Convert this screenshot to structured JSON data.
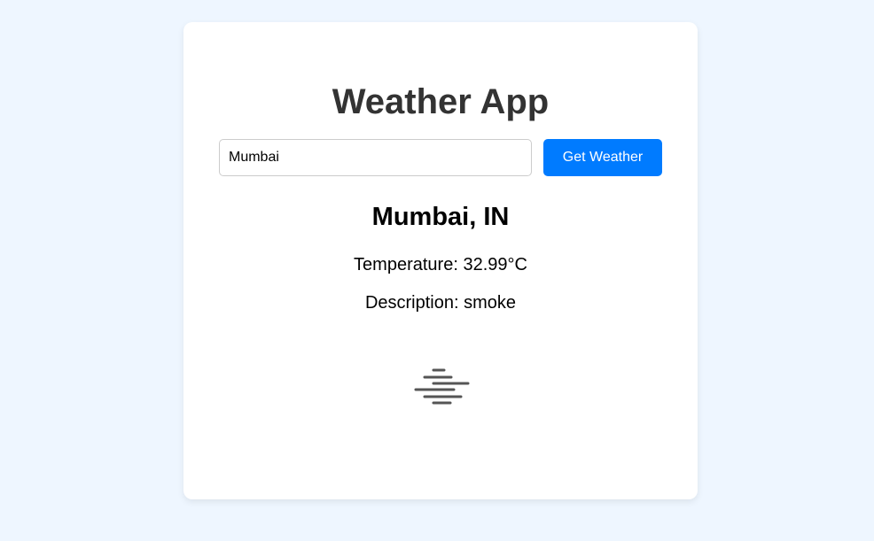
{
  "app": {
    "title": "Weather App"
  },
  "search": {
    "value": "Mumbai",
    "button_label": "Get Weather"
  },
  "result": {
    "location": "Mumbai, IN",
    "temperature_label": "Temperature:",
    "temperature_value": "32.99°C",
    "description_label": "Description:",
    "description_value": "smoke",
    "icon": "smoke-haze-icon"
  },
  "colors": {
    "background": "#eef6ff",
    "card": "#ffffff",
    "accent": "#007bff",
    "title_text": "#333333",
    "icon": "#555555"
  }
}
